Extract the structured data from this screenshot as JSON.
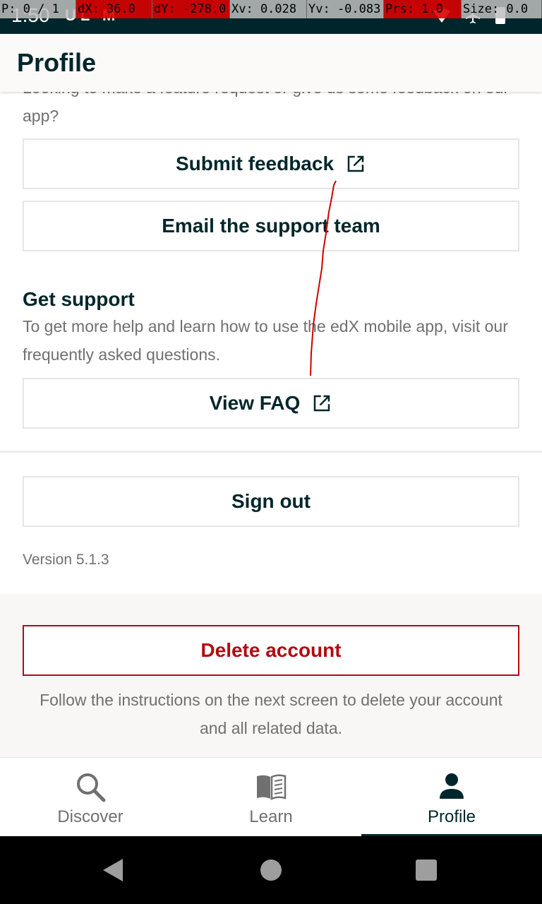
{
  "status_bar": {
    "time": "1:50",
    "left_icons": "UL M",
    "icons": [
      "wifi-icon",
      "airplane-icon",
      "battery-icon"
    ]
  },
  "debug_overlay": {
    "pointer": "P: 0 / 1",
    "dx": "dX: 36.0",
    "dy": "dY: -278.0",
    "xv": "Xv: 0.028",
    "yv": "Yv: -0.083",
    "prs": "Prs: 1.0",
    "size": "Size: 0.0"
  },
  "app_bar": {
    "title": "Profile"
  },
  "feedback": {
    "cut_text": "Looking to make a feature request or give us some feedback on our app?",
    "submit_label": "Submit feedback",
    "email_label": "Email the support team"
  },
  "support": {
    "title": "Get support",
    "description": "To get more help and learn how to use the edX mobile app, visit our frequently asked questions.",
    "faq_label": "View FAQ"
  },
  "sign_out": {
    "label": "Sign out"
  },
  "version": "Version 5.1.3",
  "delete": {
    "label": "Delete account",
    "description": "Follow the instructions on the next screen to delete your account and all related data."
  },
  "bottom_nav": {
    "items": [
      {
        "label": "Discover",
        "icon": "search-icon"
      },
      {
        "label": "Learn",
        "icon": "book-icon"
      },
      {
        "label": "Profile",
        "icon": "person-icon",
        "active": true
      }
    ]
  },
  "colors": {
    "primary": "#00262b",
    "danger": "#b20b11",
    "muted_text": "#707070",
    "trace": "#d00000"
  }
}
